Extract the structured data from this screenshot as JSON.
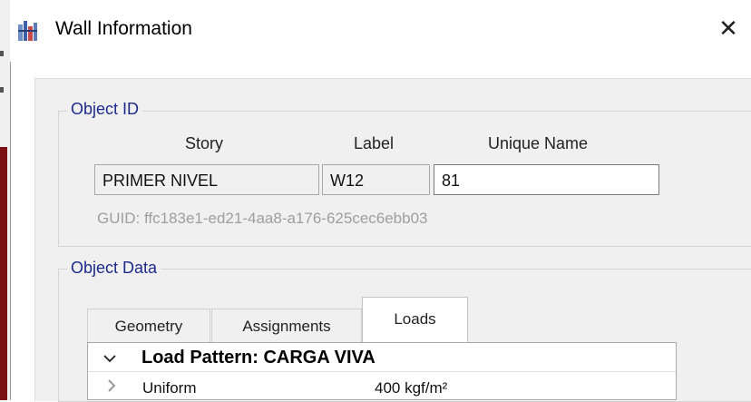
{
  "window": {
    "title": "Wall Information",
    "close_glyph": "✕"
  },
  "object_id": {
    "group_label": "Object ID",
    "columns": {
      "story": "Story",
      "label": "Label",
      "unique_name": "Unique Name"
    },
    "values": {
      "story": "PRIMER NIVEL",
      "label": "W12",
      "unique_name": "81"
    },
    "guid": "GUID: ffc183e1-ed21-4aa8-a176-625cec6ebb03"
  },
  "object_data": {
    "group_label": "Object Data",
    "tabs": [
      {
        "label": "Geometry",
        "selected": false
      },
      {
        "label": "Assignments",
        "selected": false
      },
      {
        "label": "Loads",
        "selected": true
      }
    ],
    "tree": {
      "header": "Load Pattern: CARGA VIVA",
      "rows": [
        {
          "name": "Uniform",
          "value": "400 kgf/m²"
        }
      ]
    }
  },
  "icons": {
    "app": "wall-app-icon",
    "close": "close-icon",
    "expand": "chevron-down-icon",
    "collapse": "chevron-right-icon"
  },
  "colors": {
    "group_label": "#1c2a8a",
    "background": "#f0f0f0"
  }
}
